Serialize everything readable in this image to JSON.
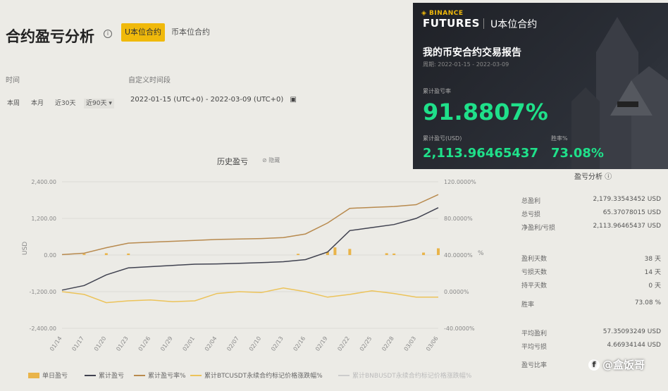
{
  "header": {
    "title": "合约盈亏分析",
    "tab_u": "U本位合约",
    "tab_coin": "币本位合约"
  },
  "filters": {
    "time_label": "时间",
    "custom_label": "自定义时间段",
    "buttons": [
      "本周",
      "本月",
      "近30天",
      "近90天 ▾"
    ],
    "date_range": "2022-01-15 (UTC+0) - 2022-03-09 (UTC+0)",
    "calendar_icon": "calendar-icon"
  },
  "chart_title": "历史盈亏",
  "chart_hide": "隐藏",
  "chart_data": {
    "type": "line",
    "x_ticks": [
      "01/14",
      "01/17",
      "01/20",
      "01/23",
      "01/26",
      "01/29",
      "02/01",
      "02/04",
      "02/07",
      "02/10",
      "02/13",
      "02/16",
      "02/19",
      "02/22",
      "02/25",
      "02/28",
      "03/03",
      "03/06"
    ],
    "y_left_ticks": [
      "2,400.00",
      "1,200.00",
      "0.00",
      "-1,200.00",
      "-2,400.00"
    ],
    "y_left_label": "USD",
    "y_right_ticks": [
      "120.0000%",
      "80.0000%",
      "40.0000%",
      "0.0000%",
      "-40.0000%"
    ],
    "y_right_label": "%",
    "ylim_left": [
      -2400,
      2400
    ],
    "ylim_right": [
      -40,
      120
    ],
    "series": [
      {
        "name": "累计盈亏",
        "color": "#404250",
        "axis": "left",
        "x": [
          "01/14",
          "01/17",
          "01/20",
          "01/23",
          "01/26",
          "01/29",
          "02/01",
          "02/04",
          "02/07",
          "02/10",
          "02/13",
          "02/16",
          "02/19",
          "02/22",
          "02/25",
          "02/28",
          "03/03",
          "03/06"
        ],
        "values": [
          -1150,
          -1000,
          -650,
          -420,
          -380,
          -340,
          -300,
          -290,
          -270,
          -250,
          -220,
          -150,
          100,
          800,
          900,
          1000,
          1200,
          1550
        ]
      },
      {
        "name": "累计盈亏率%",
        "color": "#b88a4e",
        "axis": "right",
        "x": [
          "01/14",
          "01/17",
          "01/20",
          "01/23",
          "01/26",
          "01/29",
          "02/01",
          "02/04",
          "02/07",
          "02/10",
          "02/13",
          "02/16",
          "02/19",
          "02/22",
          "02/25",
          "02/28",
          "03/03",
          "03/06"
        ],
        "values": [
          40.5,
          42,
          48,
          53,
          54,
          55,
          56,
          57,
          57.5,
          58,
          59,
          63,
          75,
          91,
          92,
          93,
          95,
          106
        ]
      },
      {
        "name": "累计BTCUSDT永续合约标记价格涨跌幅%",
        "color": "#ecc35a",
        "axis": "right",
        "x": [
          "01/14",
          "01/17",
          "01/20",
          "01/23",
          "01/26",
          "01/29",
          "02/01",
          "02/04",
          "02/07",
          "02/10",
          "02/13",
          "02/16",
          "02/19",
          "02/22",
          "02/25",
          "02/28",
          "03/03",
          "03/06"
        ],
        "values": [
          0,
          -3,
          -12,
          -10,
          -9,
          -11,
          -10,
          -2,
          0,
          -1,
          4,
          0,
          -6,
          -3,
          1,
          -2,
          -6,
          -6
        ]
      }
    ],
    "bars": {
      "name": "单日盈亏",
      "color": "#e9b44a",
      "axis": "left",
      "x": [
        "01/17",
        "01/20",
        "01/23",
        "02/15",
        "02/19",
        "02/20",
        "02/22",
        "02/27",
        "02/28",
        "03/04",
        "03/06"
      ],
      "values": [
        40,
        60,
        50,
        40,
        100,
        250,
        200,
        60,
        50,
        80,
        220
      ]
    },
    "legend_extra": "累计BNBUSDT永续合约标记价格涨跌幅%"
  },
  "stats": {
    "title": "盈亏分析",
    "rows": [
      {
        "label": "总盈利",
        "value": "2,179.33543452 USD"
      },
      {
        "label": "总亏损",
        "value": "65.37078015 USD"
      },
      {
        "label": "净盈利/亏损",
        "value": "2,113.96465437 USD"
      },
      {
        "label": "盈利天数",
        "value": "38 天"
      },
      {
        "label": "亏损天数",
        "value": "14 天"
      },
      {
        "label": "持平天数",
        "value": "0 天"
      },
      {
        "label": "胜率",
        "value": "73.08 %"
      },
      {
        "label": "平均盈利",
        "value": "57.35093249 USD"
      },
      {
        "label": "平均亏损",
        "value": "4.66934144 USD"
      },
      {
        "label": "盈亏比率",
        "value": ""
      }
    ]
  },
  "card": {
    "brand": "◈ BINANCE",
    "futures": "FUTURES",
    "contract": "U本位合约",
    "report_title": "我的币安合约交易报告",
    "period": "周期: 2022-01-15 - 2022-03-09",
    "pnl_rate_label": "累计盈亏率",
    "pnl_rate": "91.8807%",
    "pnl_label": "累计盈亏(USD)",
    "pnl": "2,113.96465437",
    "win_label": "胜率%",
    "win": "73.08%"
  },
  "watermark": "@盒饭哥"
}
